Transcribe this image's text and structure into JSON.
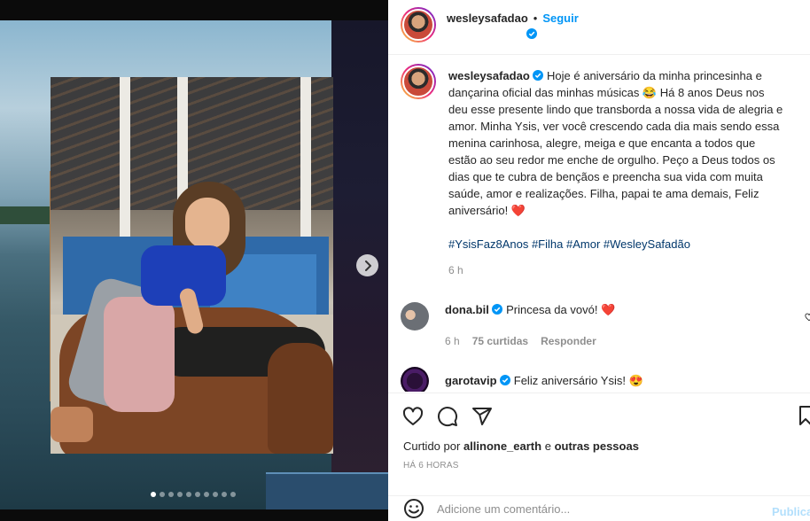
{
  "post": {
    "username": "wesleysafadao",
    "follow_label": "Seguir",
    "dot_separator": "•",
    "caption": "Hoje é aniversário da minha princesinha e dançarina oficial das minhas músicas 😂 Há 8 anos Deus nos deu esse presente lindo que transborda a nossa vida de alegria e amor. Minha Ysis, ver você crescendo cada dia mais sendo essa menina carinhosa, alegre, meiga e que encanta a todos que estão ao seu redor me enche de orgulho. Peço a Deus todos os dias que te cubra de bençãos e preencha sua vida com muita saúde, amor e realizações. Filha, papai te ama demais, Feliz aniversário! ❤️",
    "hashtags": [
      "#YsisFaz8Anos",
      "#Filha",
      "#Amor",
      "#WesleySafadão"
    ],
    "caption_time": "6 h"
  },
  "carousel": {
    "total_slides": 10,
    "active_index": 0
  },
  "comments": [
    {
      "username": "dona.bil",
      "text": "Princesa da vovó! ❤️",
      "time": "6 h",
      "likes": "75 curtidas",
      "reply_label": "Responder"
    },
    {
      "username": "garotavip",
      "text": "Feliz aniversário Ysis! 😍"
    }
  ],
  "engagement": {
    "liked_by_prefix": "Curtido por",
    "liked_by_user": "allinone_earth",
    "liked_by_connector": "e",
    "liked_by_suffix": "outras pessoas",
    "posted_time": "HÁ 6 HORAS"
  },
  "composer": {
    "placeholder": "Adicione um comentário...",
    "publish_label": "Publicar"
  },
  "colors": {
    "accent": "#0095f6",
    "link": "#00376b",
    "heart": "#ed4956",
    "muted": "#8e8e8e"
  }
}
